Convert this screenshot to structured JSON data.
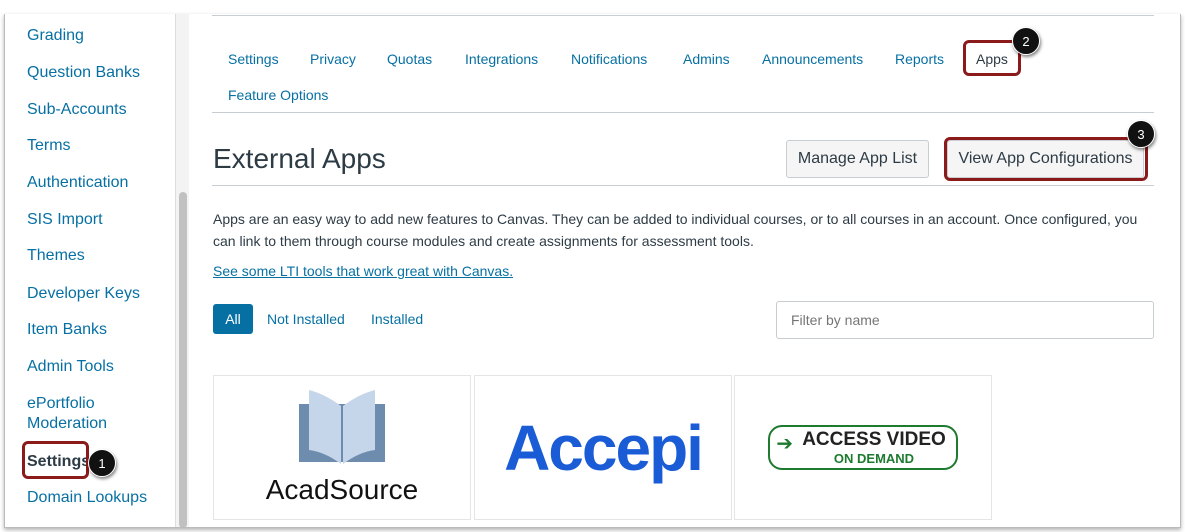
{
  "sidebar": {
    "items": [
      "Grading",
      "Question Banks",
      "Sub-Accounts",
      "Terms",
      "Authentication",
      "SIS Import",
      "Themes",
      "Developer Keys",
      "Item Banks",
      "Admin Tools",
      "ePortfolio Moderation",
      "Settings",
      "Domain Lookups"
    ]
  },
  "tabs": [
    "Settings",
    "Privacy",
    "Quotas",
    "Integrations",
    "Notifications",
    "Admins",
    "Announcements",
    "Reports",
    "Apps",
    "Feature Options"
  ],
  "page": {
    "title": "External Apps",
    "manage_label": "Manage App List",
    "view_label": "View App Configurations",
    "description": "Apps are an easy way to add new features to Canvas. They can be added to individual courses, or to all courses in an account. Once configured, you can link to them through course modules and create assignments for assessment tools.",
    "link": "See some LTI tools that work great with Canvas.",
    "filters": [
      "All",
      "Not Installed",
      "Installed"
    ],
    "filter_placeholder": "Filter by name"
  },
  "apps": [
    {
      "name": "AcadSource"
    },
    {
      "name": "Accepi"
    },
    {
      "name": "ACCESS VIDEO",
      "sub": "ON DEMAND"
    }
  ],
  "badges": [
    "1",
    "2",
    "3"
  ]
}
